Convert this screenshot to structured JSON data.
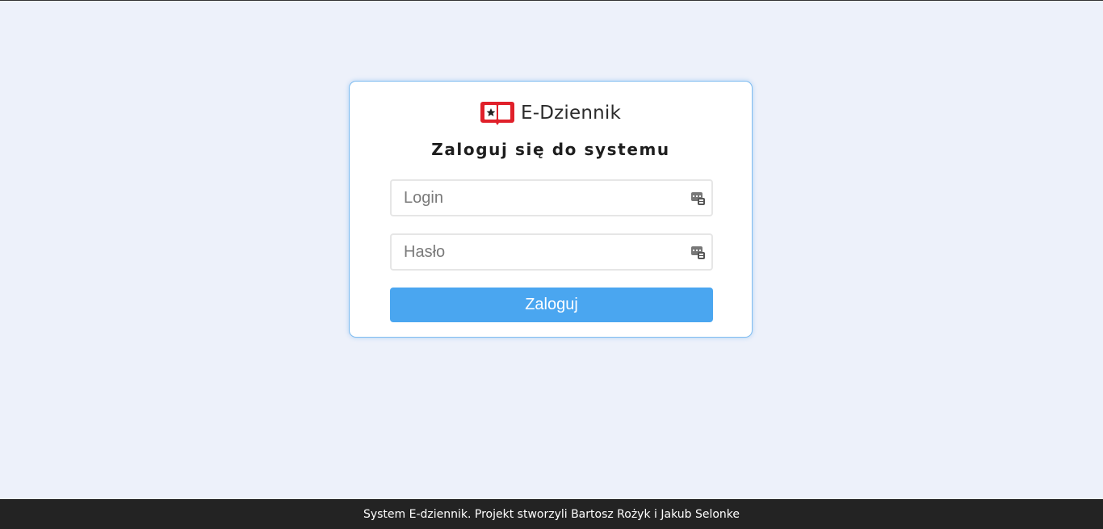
{
  "app": {
    "brand_name": "E-Dziennik",
    "logo_icon": "book-star-icon",
    "logo_color": "#e0202a"
  },
  "login_form": {
    "heading": "Zaloguj się do systemu",
    "login_placeholder": "Login",
    "login_value": "",
    "password_placeholder": "Hasło",
    "password_value": "",
    "field_icon": "password-manager-icon",
    "submit_label": "Zaloguj",
    "accent_color": "#4aa6f0"
  },
  "footer": {
    "text": "System E-dziennik. Projekt stworzyli Bartosz Rożyk i Jakub Selonke"
  }
}
